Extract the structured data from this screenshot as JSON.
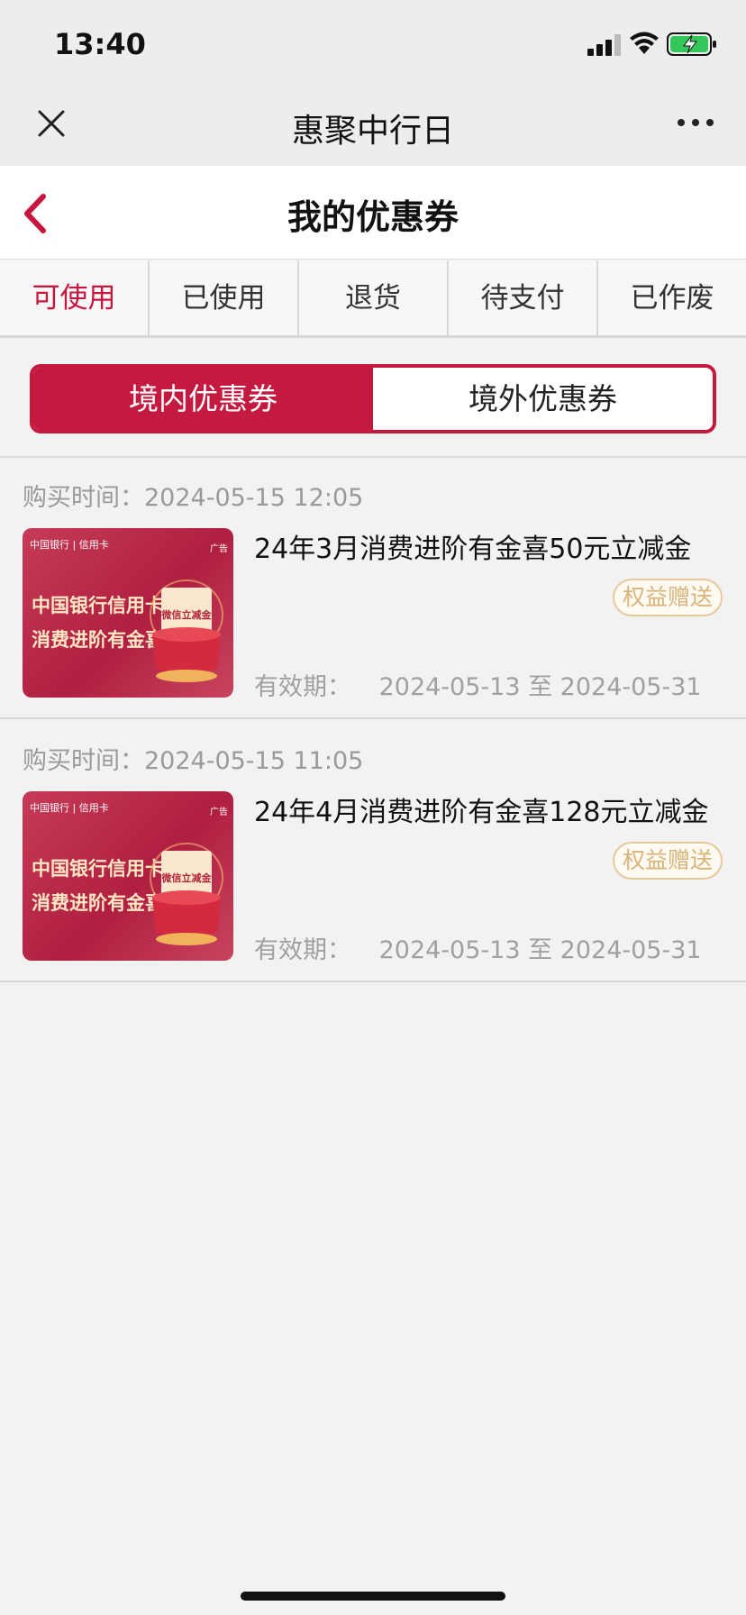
{
  "status_bar": {
    "time": "13:40"
  },
  "wechat_nav": {
    "title": "惠聚中行日"
  },
  "page": {
    "title": "我的优惠券"
  },
  "status_tabs": [
    {
      "label": "可使用",
      "active": true
    },
    {
      "label": "已使用",
      "active": false
    },
    {
      "label": "退货",
      "active": false
    },
    {
      "label": "待支付",
      "active": false
    },
    {
      "label": "已作废",
      "active": false
    }
  ],
  "segment": [
    {
      "label": "境内优惠券",
      "active": true
    },
    {
      "label": "境外优惠券",
      "active": false
    }
  ],
  "coupon_image": {
    "logo_text": "中国银行 | 信用卡",
    "ad_text": "广告",
    "line1": "中国银行信用卡",
    "line2": "消费进阶有金喜",
    "pot_text": "微信立减金"
  },
  "coupons": [
    {
      "buy_time": "购买时间：2024-05-15 12:05",
      "name": "24年3月消费进阶有金喜50元立减金",
      "badge": "权益赠送",
      "validity_label": "有效期：",
      "validity_range": "2024-05-13 至 2024-05-31"
    },
    {
      "buy_time": "购买时间：2024-05-15 11:05",
      "name": "24年4月消费进阶有金喜128元立减金",
      "badge": "权益赠送",
      "validity_label": "有效期：",
      "validity_range": "2024-05-13 至 2024-05-31"
    }
  ],
  "colors": {
    "accent": "#c41a40",
    "badge": "#d9b47a"
  }
}
